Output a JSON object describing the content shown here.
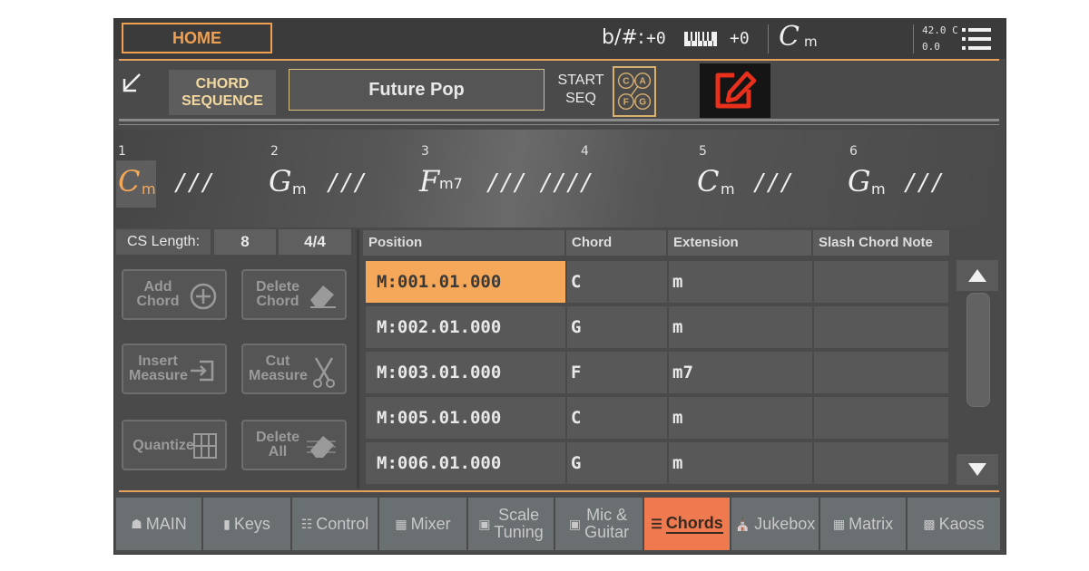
{
  "header": {
    "home_label": "HOME",
    "transpose_glyph": "b/#:",
    "transpose_value": "+0",
    "octave_value": "+0",
    "chord_root": "C",
    "chord_ext": "m",
    "tempo_line1": "42.0 C",
    "tempo_line2": "0.0"
  },
  "page": {
    "title": "CHORD SEQUENCE",
    "title_line1": "CHORD",
    "title_line2": "SEQUENCE",
    "sequence_name": "Future Pop",
    "start_seq_line1": "START",
    "start_seq_line2": "SEQ",
    "seq_icon_letters": [
      "C",
      "A",
      "F",
      "G"
    ]
  },
  "strip": {
    "measures": [
      {
        "num": "1",
        "root": "C",
        "ext": "m",
        "slashes": "///"
      },
      {
        "num": "2",
        "root": "G",
        "ext": "m",
        "slashes": "///"
      },
      {
        "num": "3",
        "root": "F",
        "ext": "m7",
        "slashes": "/// ////"
      },
      {
        "num": "4",
        "root": "",
        "ext": "",
        "slashes": ""
      },
      {
        "num": "5",
        "root": "C",
        "ext": "m",
        "slashes": "///"
      },
      {
        "num": "6",
        "root": "G",
        "ext": "m",
        "slashes": "///"
      }
    ]
  },
  "controls": {
    "cs_length_label": "CS Length:",
    "cs_length_value": "8",
    "meter": "4/4",
    "buttons": [
      {
        "line1": "Add",
        "line2": "Chord"
      },
      {
        "line1": "Delete",
        "line2": "Chord"
      },
      {
        "line1": "Insert",
        "line2": "Measure"
      },
      {
        "line1": "Cut",
        "line2": "Measure"
      },
      {
        "line1": "Quantize",
        "line2": ""
      },
      {
        "line1": "Delete",
        "line2": "All"
      }
    ]
  },
  "table": {
    "columns": [
      "Position",
      "Chord",
      "Extension",
      "Slash Chord Note"
    ],
    "rows": [
      {
        "position": "M:001.01.000",
        "chord": "C",
        "extension": "m",
        "slash": ""
      },
      {
        "position": "M:002.01.000",
        "chord": "G",
        "extension": "m",
        "slash": ""
      },
      {
        "position": "M:003.01.000",
        "chord": "F",
        "extension": "m7",
        "slash": ""
      },
      {
        "position": "M:005.01.000",
        "chord": "C",
        "extension": "m",
        "slash": ""
      },
      {
        "position": "M:006.01.000",
        "chord": "G",
        "extension": "m",
        "slash": ""
      }
    ],
    "selected_row": 0
  },
  "tabs": [
    {
      "label": "MAIN",
      "icon": "house-icon"
    },
    {
      "label": "Keys",
      "icon": "keys-icon"
    },
    {
      "label": "Control",
      "icon": "control-icon"
    },
    {
      "label": "Mixer",
      "icon": "mixer-icon"
    },
    {
      "label": "Scale Tuning",
      "line1": "Scale",
      "line2": "Tuning",
      "icon": "scale-icon"
    },
    {
      "label": "Mic & Guitar",
      "line1": "Mic &",
      "line2": "Guitar",
      "icon": "mic-icon"
    },
    {
      "label": "Chords",
      "icon": "chords-icon",
      "active": true
    },
    {
      "label": "Jukebox",
      "icon": "jukebox-icon"
    },
    {
      "label": "Matrix",
      "icon": "matrix-icon"
    },
    {
      "label": "Kaoss",
      "icon": "kaoss-icon"
    }
  ],
  "colors": {
    "accent": "#f0a050",
    "selected_row": "#f6a85a",
    "active_tab": "#f07a50",
    "edit_icon": "#e8301c"
  }
}
